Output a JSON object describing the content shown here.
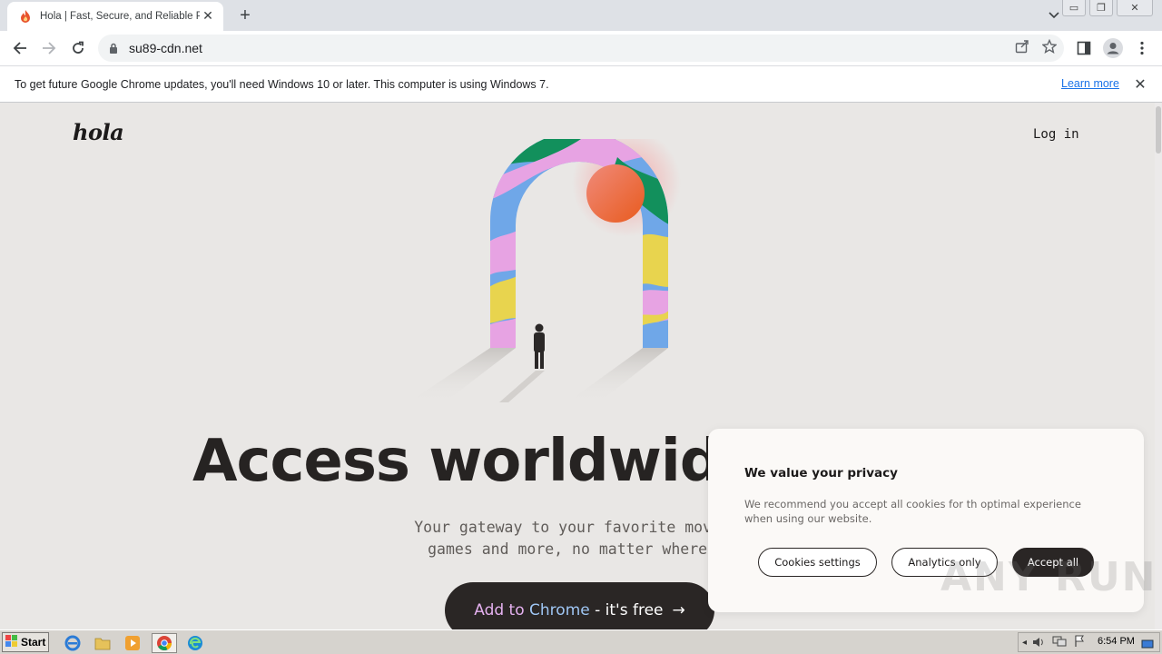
{
  "browser": {
    "tab": {
      "title": "Hola | Fast, Secure, and Reliable Proxy",
      "favicon": "hola-flame-icon"
    },
    "url": "su89-cdn.net",
    "infobar": {
      "message": "To get future Google Chrome updates, you'll need Windows 10 or later. This computer is using Windows 7.",
      "link": "Learn more"
    }
  },
  "page": {
    "logo": "hola",
    "login": "Log in",
    "headline": "Access worldwide",
    "subtext_line1": "Your gateway to your favorite movies,",
    "subtext_line2": "games and more, no matter where yo",
    "cta": {
      "part1": "Add to ",
      "part2": "Chrome",
      "part3": " - it's free",
      "arrow": "→"
    }
  },
  "cookie_dialog": {
    "title": "We value your privacy",
    "text": "We recommend you accept all cookies for th optimal experience when using our website.",
    "buttons": {
      "settings": "Cookies settings",
      "analytics": "Analytics only",
      "accept": "Accept all"
    }
  },
  "watermark": "ANY RUN",
  "taskbar": {
    "start": "Start",
    "clock": "6:54 PM"
  },
  "colors": {
    "page_bg": "#e9e7e5",
    "button_dark": "#2a2625",
    "link": "#1a73e8"
  }
}
